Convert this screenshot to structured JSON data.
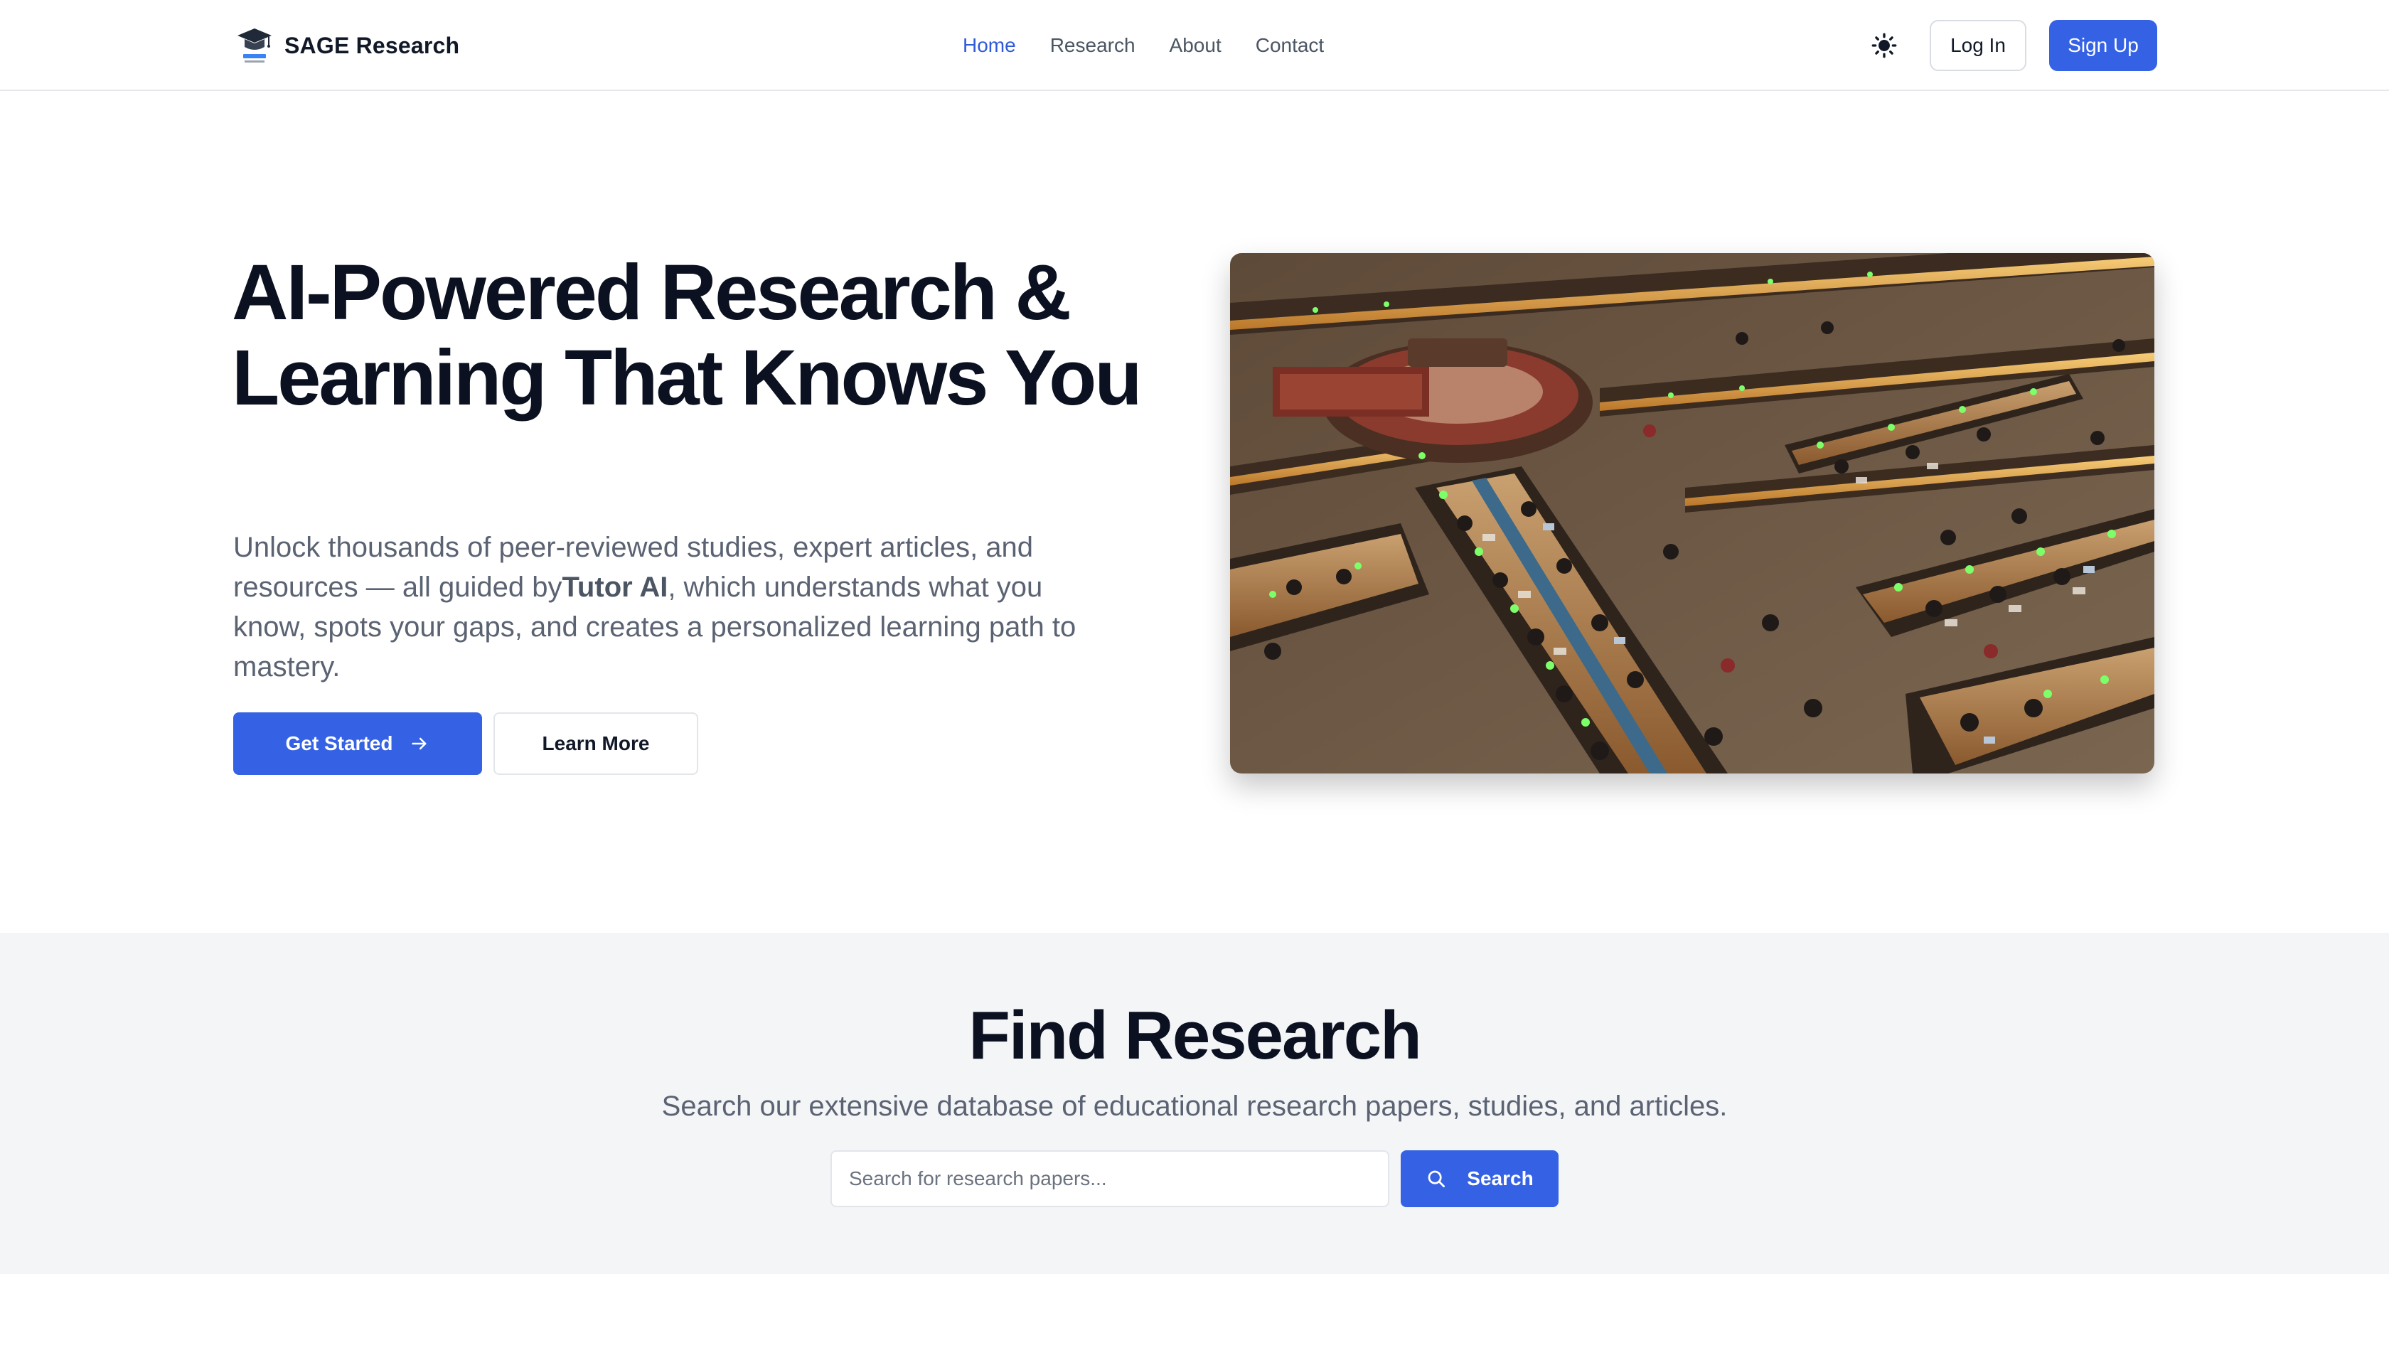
{
  "header": {
    "brand_name": "SAGE Research",
    "nav": [
      {
        "label": "Home",
        "active": true
      },
      {
        "label": "Research",
        "active": false
      },
      {
        "label": "About",
        "active": false
      },
      {
        "label": "Contact",
        "active": false
      }
    ],
    "theme_icon": "sun-icon",
    "login_label": "Log In",
    "signup_label": "Sign Up"
  },
  "hero": {
    "title": "AI-Powered Research & Learning That Knows You",
    "desc_before": "Unlock thousands of peer-reviewed studies, expert articles, and resources — all guided by",
    "desc_highlight": "Tutor AI",
    "desc_after": ", which understands what you know, spots your gaps, and creates a personalized learning path to mastery.",
    "primary_button": "Get Started",
    "primary_button_icon": "arrow-right-icon",
    "secondary_button": "Learn More",
    "image_subject": "library-reading-room-photo"
  },
  "find": {
    "title": "Find Research",
    "subtitle": "Search our extensive database of educational research papers, studies, and articles.",
    "search_placeholder": "Search for research papers...",
    "search_value": "",
    "search_button": "Search",
    "search_icon": "search-icon"
  },
  "colors": {
    "accent": "#3562e4",
    "nav_active": "#2f5bd9",
    "heading": "#0b1120",
    "muted_text": "#5b6373",
    "section_bg": "#f4f5f7"
  }
}
